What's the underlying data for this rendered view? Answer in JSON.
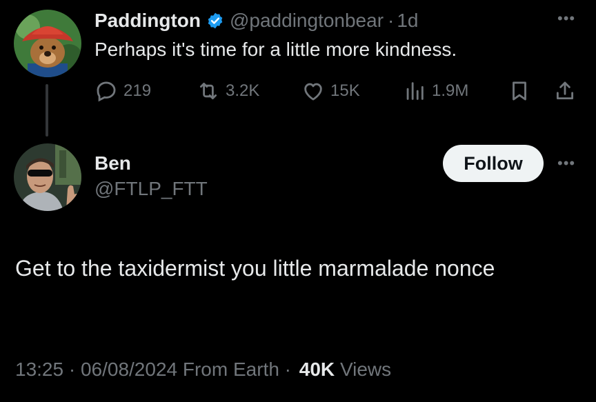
{
  "parent_tweet": {
    "display_name": "Paddington",
    "handle": "@paddingtonbear",
    "separator": "·",
    "age": "1d",
    "text": "Perhaps it's time for a little more kindness.",
    "verified_color": "#1d9bf0",
    "actions": {
      "replies": "219",
      "reposts": "3.2K",
      "likes": "15K",
      "views": "1.9M"
    }
  },
  "main_tweet": {
    "display_name": "Ben",
    "handle": "@FTLP_FTT",
    "follow_label": "Follow",
    "text": "Get to the taxidermist you little marmalade nonce",
    "timestamp": "13:25 · 06/08/2024 From Earth ·",
    "views_count": "40K",
    "views_label": "Views"
  },
  "colors": {
    "background": "#000000",
    "text": "#e7e9ea",
    "muted": "#71767b",
    "accent": "#1d9bf0"
  },
  "icons": [
    "reply-icon",
    "repost-icon",
    "like-icon",
    "views-icon",
    "bookmark-icon",
    "share-icon",
    "more-icon",
    "verified-icon"
  ]
}
